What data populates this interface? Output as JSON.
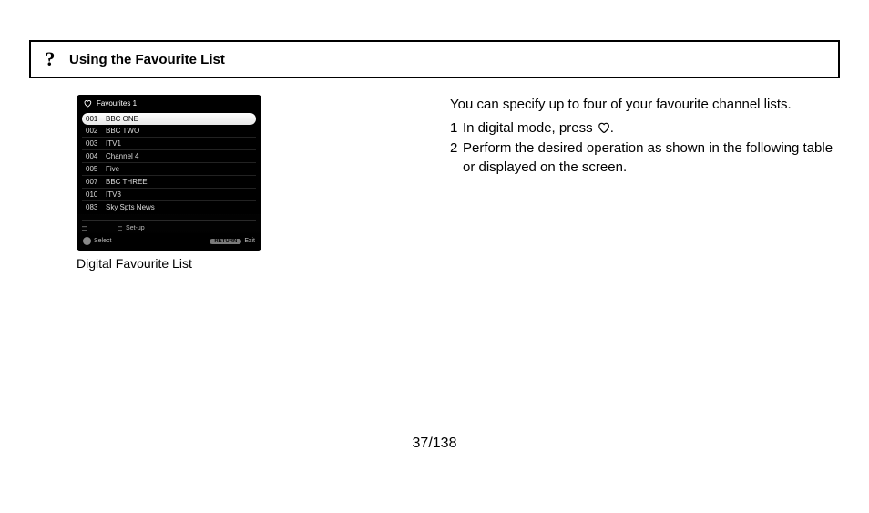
{
  "header": {
    "title": "Using the Favourite List"
  },
  "figure": {
    "caption": "Digital Favourite List",
    "tv": {
      "title": "Favourites 1",
      "channels": [
        {
          "num": "001",
          "name": "BBC ONE"
        },
        {
          "num": "002",
          "name": "BBC TWO"
        },
        {
          "num": "003",
          "name": "ITV1"
        },
        {
          "num": "004",
          "name": "Channel 4"
        },
        {
          "num": "005",
          "name": "Five"
        },
        {
          "num": "007",
          "name": "BBC THREE"
        },
        {
          "num": "010",
          "name": "ITV3"
        },
        {
          "num": "083",
          "name": "Sky Spts News"
        }
      ],
      "setup_label": "Set-up",
      "select_label": "Select",
      "return_label": "RETURN",
      "exit_label": "Exit"
    }
  },
  "body": {
    "intro": "You can specify up to four of your favourite channel lists.",
    "step1_prefix": "In digital mode, press ",
    "step1_suffix": ".",
    "step2": "Perform the desired operation as shown in the following table or displayed on the screen."
  },
  "page_number": "37/138"
}
